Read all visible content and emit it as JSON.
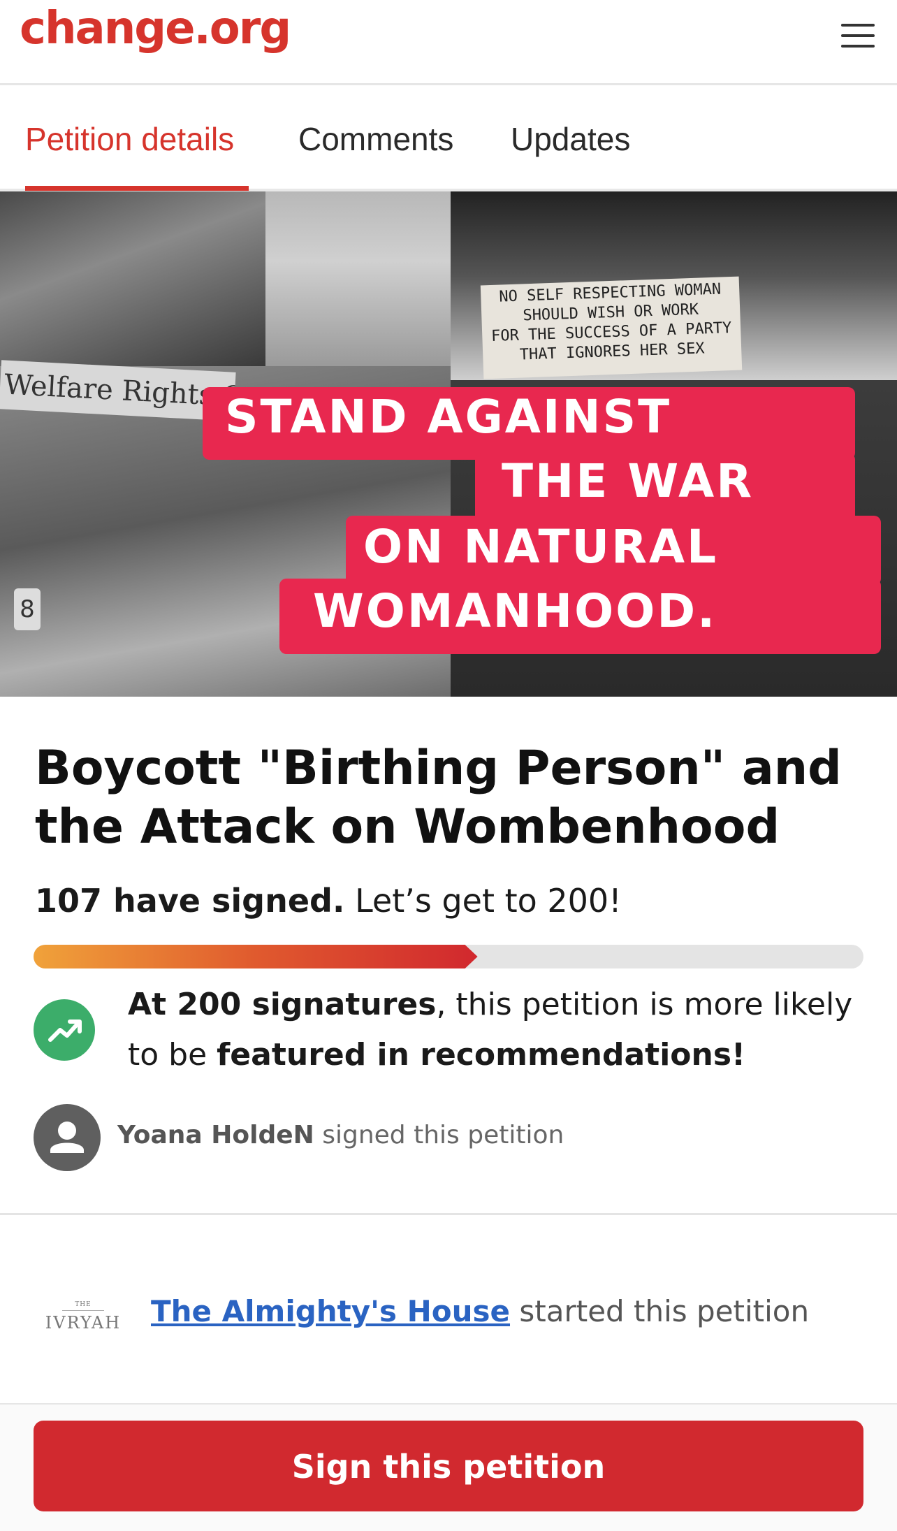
{
  "header": {
    "logo_text": "change.org",
    "menu_icon": "hamburger-menu-icon"
  },
  "tabs": [
    {
      "label": "Petition details",
      "active": true
    },
    {
      "label": "Comments",
      "active": false
    },
    {
      "label": "Updates",
      "active": false
    }
  ],
  "hero": {
    "photo_texts": {
      "protest_sign": "Welfare Rights Organiza",
      "banner_lines": [
        "NO SELF RESPECTING WOMAN",
        "SHOULD WISH OR WORK",
        "FOR THE SUCCESS OF A PARTY",
        "THAT IGNORES HER SEX"
      ],
      "badge_number": "8"
    },
    "slogan": [
      "STAND AGAINST",
      "THE WAR",
      "ON NATURAL",
      "WOMANHOOD."
    ]
  },
  "petition": {
    "title": "Boycott \"Birthing Person\" and the Attack on Wombenhood",
    "signed_count": "107 have signed.",
    "goal_text": " Let’s get to 200!",
    "progress_fraction": 0.535,
    "milestone": {
      "part1": "At 200 signatures",
      "part2": ", this petition is more likely to be ",
      "part3": "featured in recommendations!"
    },
    "recent_signer": {
      "name": "Yoana HoldeN",
      "action": " signed this petition"
    },
    "starter": {
      "logo_text": "IVRYAH",
      "name": "The Almighty's House",
      "action": " started this petition"
    }
  },
  "cta": {
    "label": "Sign this petition"
  },
  "colors": {
    "brand": "#d6342c",
    "slogan_box": "#e8284f",
    "trend": "#3cad6a",
    "cta": "#d1292f",
    "link": "#2a63c2"
  }
}
